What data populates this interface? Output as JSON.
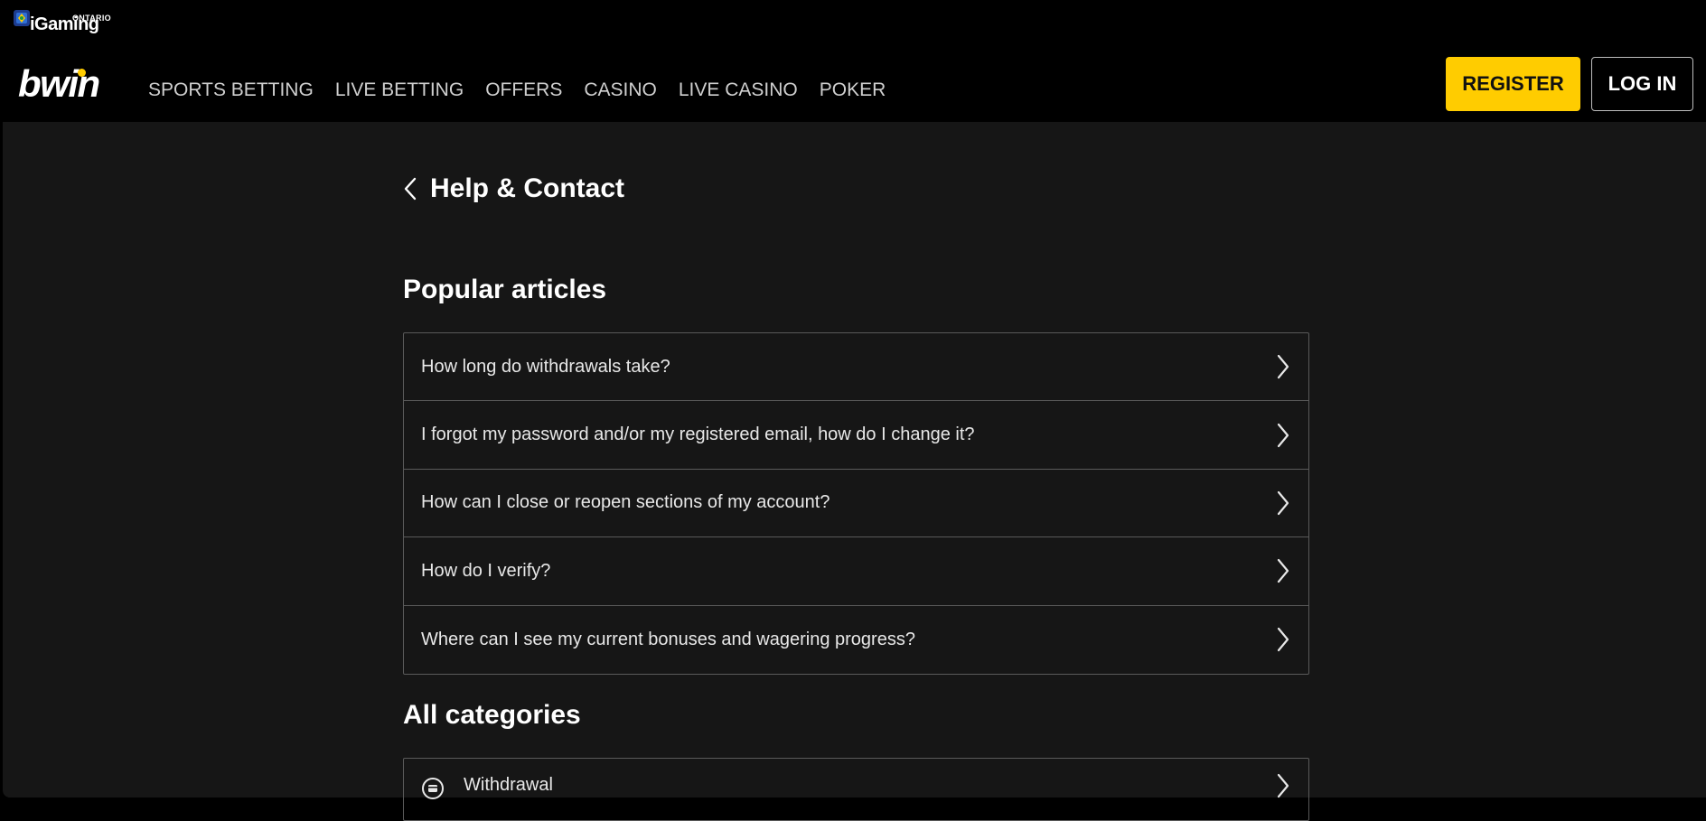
{
  "header": {
    "badge_text": "iGaming",
    "badge_region": "ONTARIO",
    "logo": "bwin",
    "nav": [
      {
        "label": "SPORTS BETTING"
      },
      {
        "label": "LIVE BETTING"
      },
      {
        "label": "OFFERS"
      },
      {
        "label": "CASINO"
      },
      {
        "label": "LIVE CASINO"
      },
      {
        "label": "POKER"
      }
    ],
    "register_label": "REGISTER",
    "login_label": "LOG IN",
    "accent_color": "#ffcc00"
  },
  "page": {
    "title": "Help & Contact",
    "back_icon": "chevron-left-icon"
  },
  "popular": {
    "title": "Popular articles",
    "items": [
      {
        "label": "How long do withdrawals take?"
      },
      {
        "label": "I forgot my password and/or my registered email, how do I change it?"
      },
      {
        "label": "How can I close or reopen sections of my account?"
      },
      {
        "label": "How do I verify?"
      },
      {
        "label": "Where can I see my current bonuses and wagering progress?"
      }
    ]
  },
  "categories": {
    "title": "All categories",
    "items": [
      {
        "label": "Withdrawal",
        "icon": "withdrawal-icon"
      }
    ]
  }
}
